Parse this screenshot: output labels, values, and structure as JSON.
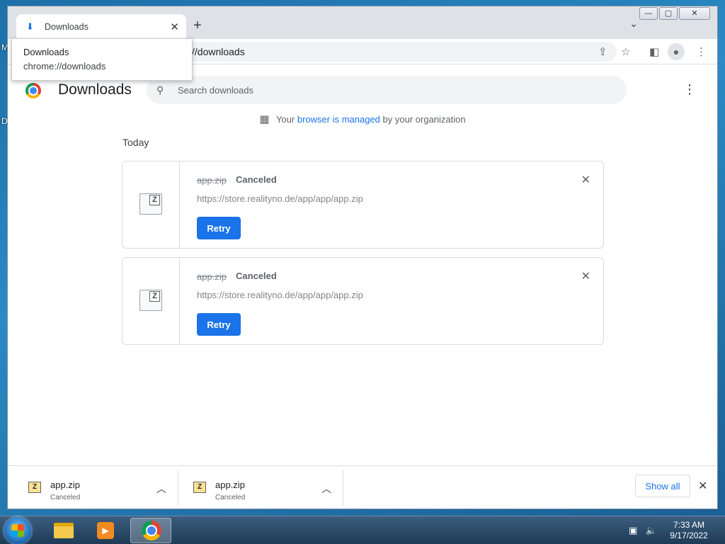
{
  "desktop": {
    "stub_top": "M",
    "stub_mid": "D"
  },
  "window": {
    "minimize": "—",
    "maximize": "▢",
    "close": "✕"
  },
  "tab": {
    "title": "Downloads",
    "close": "✕",
    "new_tab": "+",
    "search": "⌄"
  },
  "tooltip": {
    "title": "Downloads",
    "url": "chrome://downloads"
  },
  "toolbar": {
    "address": "//downloads"
  },
  "page": {
    "title": "Downloads",
    "search_placeholder": "Search downloads",
    "managed_prefix": "Your",
    "managed_link": "browser is managed",
    "managed_suffix": "by your organization",
    "section": "Today"
  },
  "downloads": [
    {
      "name": "app.zip",
      "status": "Canceled",
      "url": "https://store.realityno.de/app/app/app.zip",
      "retry": "Retry"
    },
    {
      "name": "app.zip",
      "status": "Canceled",
      "url": "https://store.realityno.de/app/app/app.zip",
      "retry": "Retry"
    }
  ],
  "shelf": {
    "items": [
      {
        "name": "app.zip",
        "status": "Canceled"
      },
      {
        "name": "app.zip",
        "status": "Canceled"
      }
    ],
    "show_all": "Show all"
  },
  "taskbar": {
    "time": "7:33 AM",
    "date": "9/17/2022"
  },
  "colors": {
    "accent": "#1a73e8",
    "chrome_frame": "#dee1e6"
  }
}
